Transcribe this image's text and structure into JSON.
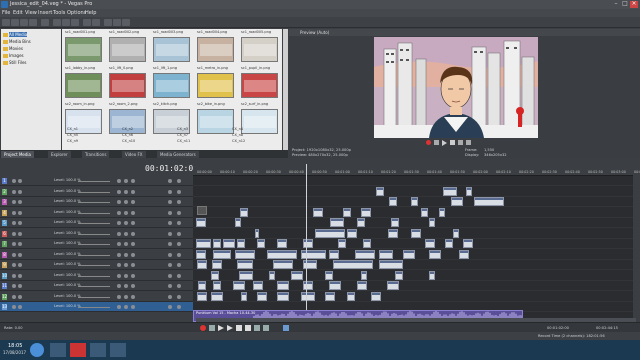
{
  "window": {
    "title": "Jessica_edit_04.veg * - Vegas Pro",
    "minimize": "–",
    "maximize": "□",
    "close": "×"
  },
  "menu": [
    "File",
    "Edit",
    "View",
    "Insert",
    "Tools",
    "Options",
    "Help"
  ],
  "tree": [
    {
      "label": "All Media"
    },
    {
      "label": "Media Bins"
    },
    {
      "label": "Movies"
    },
    {
      "label": "Images"
    },
    {
      "label": "Still Files"
    }
  ],
  "media": [
    {
      "name": "sc1_road001.png",
      "c": "#7a9a6e"
    },
    {
      "name": "sc1_road002.png",
      "c": "#b0b0b0"
    },
    {
      "name": "sc1_road003.png",
      "c": "#a8c3d6"
    },
    {
      "name": "sc1_road004.png",
      "c": "#c7b2a1"
    },
    {
      "name": "sc1_road005.png",
      "c": "#d4d0c8"
    },
    {
      "name": "sc1_lobby_in.png",
      "c": "#6f8f5a"
    },
    {
      "name": "sc1_lift_0.png",
      "c": "#c23f3f"
    },
    {
      "name": "sc1_lift_1.png",
      "c": "#7eb3d0"
    },
    {
      "name": "sc1_metro_in.png",
      "c": "#e0c14b"
    },
    {
      "name": "sc1_pupil_in.png",
      "c": "#c94646"
    },
    {
      "name": "sc2_room_in.png",
      "c": "#d8e2ee"
    },
    {
      "name": "sc2_room_2.png",
      "c": "#9cb5d2"
    },
    {
      "name": "sc2_kitch.png",
      "c": "#c8cfd6"
    },
    {
      "name": "sc2_bike_in.png",
      "c": "#b9d5e4"
    },
    {
      "name": "sc2_surf_in.png",
      "c": "#d7e6ee"
    }
  ],
  "media_files": [
    [
      "CX_n1",
      "CX_n2",
      "CX_n3",
      "CX_n4"
    ],
    [
      "CX_n5",
      "CX_n6",
      "CX_n7",
      "CX_n8"
    ],
    [
      "CX_n9",
      "CX_n10",
      "CX_n11",
      "CX_n12"
    ]
  ],
  "tabs": [
    "Project Media",
    "Explorer",
    "Transitions",
    "Video FX",
    "Media Generators"
  ],
  "preview": {
    "title": "Preview (Auto)",
    "project": "Project: 1920x1080x32, 25.000p",
    "preview": "Preview: 480x270x32, 25.000p",
    "frame_label": "Frame:",
    "frame_value": "1,550",
    "display_label": "Display:",
    "display_value": "346x205x32"
  },
  "timecode": "00:01:02:00",
  "ruler": [
    "00:00:00",
    "00:00:10",
    "00:00:20",
    "00:00:30",
    "00:00:40",
    "00:00:50",
    "00:01:00",
    "00:01:10",
    "00:01:20",
    "00:01:30",
    "00:01:40",
    "00:01:50",
    "00:02:00",
    "00:02:10",
    "00:02:20",
    "00:02:30",
    "00:02:40",
    "00:02:50",
    "00:03:00",
    "00:03:10"
  ],
  "tracks": [
    {
      "n": "1",
      "level": "Level: 100.0 %",
      "color": "#5b7bc9"
    },
    {
      "n": "2",
      "level": "Level: 100.0 %",
      "color": "#5fa35f"
    },
    {
      "n": "3",
      "level": "Level: 100.0 %",
      "color": "#b65bb0"
    },
    {
      "n": "4",
      "level": "Level: 100.0 %",
      "color": "#c9a25b"
    },
    {
      "n": "5",
      "level": "Level: 100.0 %",
      "color": "#5b9dc9"
    },
    {
      "n": "6",
      "level": "Level: 100.0 %",
      "color": "#c95b5b"
    },
    {
      "n": "7",
      "level": "Level: 100.0 %",
      "color": "#5fa35f"
    },
    {
      "n": "8",
      "level": "Level: 100.0 %",
      "color": "#b65bb0"
    },
    {
      "n": "9",
      "level": "Level: 100.0 %",
      "color": "#c9a25b"
    },
    {
      "n": "10",
      "level": "Level: 100.0 %",
      "color": "#5b9dc9"
    },
    {
      "n": "11",
      "level": "Level: 100.0 %",
      "color": "#5b7bc9"
    },
    {
      "n": "12",
      "level": "Level: 100.0 %",
      "color": "#5fa35f"
    },
    {
      "n": "13",
      "level": "Level: 100.0 %",
      "color": "#6b9bd1"
    }
  ],
  "audio": {
    "label": "Punktum Vol 15 - Mocha 10-44-30"
  },
  "bottom": {
    "rate": "Rate: 0.00",
    "pos": "00:01:02:00",
    "end": "00:02:44:15"
  },
  "status": {
    "left": "",
    "right": "Record Time (2 channels): 182:01:56"
  },
  "taskbar": {
    "time": "18:05",
    "date": "17/08/2017"
  }
}
